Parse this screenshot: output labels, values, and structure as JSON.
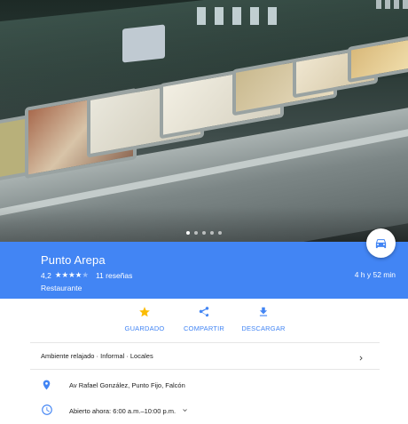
{
  "hero": {
    "photo_indicator_count": 5,
    "active_photo_index": 0
  },
  "place": {
    "name": "Punto Arepa",
    "rating": "4,2",
    "rating_value": 4.2,
    "star_count": 5,
    "reviews": "11 reseñas",
    "category": "Restaurante",
    "travel_time": "4 h y 52 min"
  },
  "fab": {
    "icon": "car-icon"
  },
  "actions": [
    {
      "label": "GUARDADO",
      "icon": "star-icon"
    },
    {
      "label": "COMPARTIR",
      "icon": "share-icon"
    },
    {
      "label": "DESCARGAR",
      "icon": "download-icon"
    }
  ],
  "attributes": "Ambiente relajado · Informal · Locales",
  "address": "Av Rafael González, Punto Fijo, Falcón",
  "hours": "Abierto ahora: 6:00 a.m.–10:00 p.m.",
  "colors": {
    "header_blue": "#4285f4",
    "saved_star": "#fbbc04",
    "icon_blue": "#4285f4"
  }
}
